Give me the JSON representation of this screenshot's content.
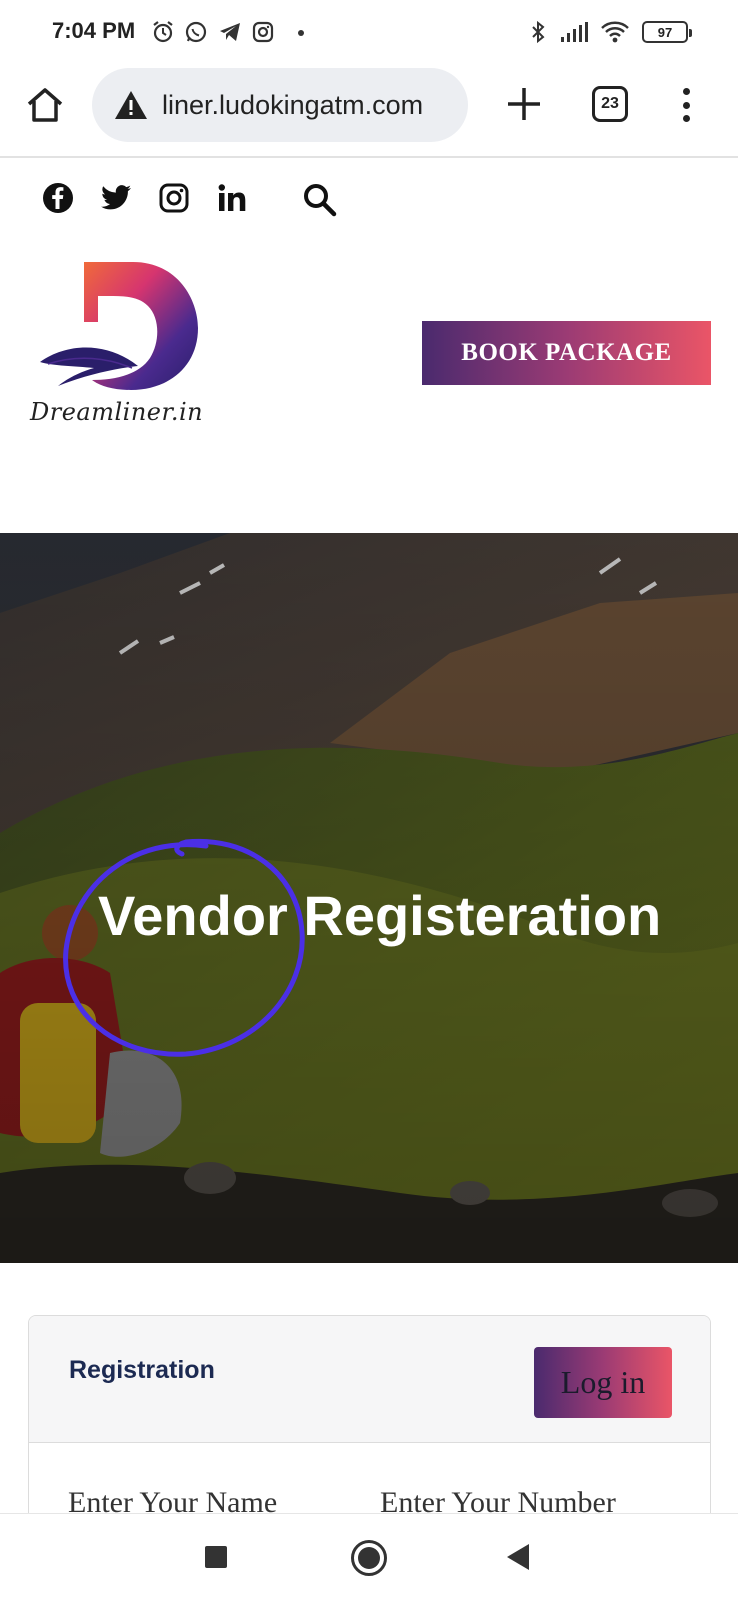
{
  "status_bar": {
    "time": "7:04 PM",
    "battery": "97",
    "icons_left": [
      "alarm-icon",
      "whatsapp-icon",
      "telegram-icon",
      "instagram-icon"
    ],
    "icons_right": [
      "bluetooth-icon",
      "signal-icon",
      "wifi-icon",
      "battery-icon"
    ]
  },
  "browser": {
    "url": "liner.ludokingatm.com",
    "tab_count": "23",
    "icons": [
      "home-icon",
      "warning-icon",
      "plus-icon",
      "tabs-icon",
      "more-vertical-icon"
    ]
  },
  "header": {
    "social": [
      "facebook-icon",
      "twitter-icon",
      "instagram-icon",
      "linkedin-icon"
    ],
    "search_icon": "search-icon",
    "logo_text": "Dreamliner.in",
    "book_button": "BOOK PACKAGE",
    "brand_gradient": [
      "#4a2a6e",
      "#9b3b74",
      "#ea5567"
    ]
  },
  "hero": {
    "title": "Vendor Registeration",
    "annotation_color": "#4b2fe6"
  },
  "registration": {
    "title": "Registration",
    "login_button": "Log in",
    "name_label": "Enter Your Name",
    "number_label": "Enter Your Number"
  },
  "nav_bar": {
    "icons": [
      "recent-apps-icon",
      "home-circle-icon",
      "back-icon"
    ]
  }
}
